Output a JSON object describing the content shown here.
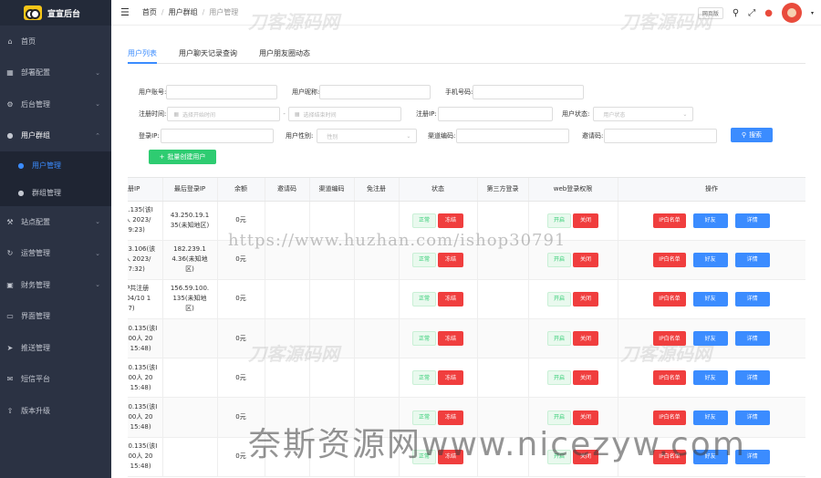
{
  "app": {
    "title": "宣宣后台"
  },
  "sidebar": {
    "items": [
      {
        "label": "首页",
        "icon": "home-icon",
        "chevron": false
      },
      {
        "label": "部署配置",
        "icon": "grid-icon",
        "chevron": true
      },
      {
        "label": "后台管理",
        "icon": "gear-icon",
        "chevron": true
      },
      {
        "label": "用户群组",
        "icon": "user-icon",
        "chevron": true,
        "open": true
      },
      {
        "label": "用户管理",
        "icon": "user-icon",
        "sub": true,
        "active": true
      },
      {
        "label": "群组管理",
        "icon": "users-icon",
        "sub": true
      },
      {
        "label": "站点配置",
        "icon": "wrench-icon",
        "chevron": true
      },
      {
        "label": "运营管理",
        "icon": "refresh-icon",
        "chevron": true
      },
      {
        "label": "财务管理",
        "icon": "wallet-icon",
        "chevron": true
      },
      {
        "label": "界面管理",
        "icon": "monitor-icon",
        "chevron": false
      },
      {
        "label": "推送管理",
        "icon": "send-icon",
        "chevron": false
      },
      {
        "label": "短信平台",
        "icon": "message-icon",
        "chevron": false
      },
      {
        "label": "版本升级",
        "icon": "upgrade-icon",
        "chevron": false
      }
    ]
  },
  "header": {
    "breadcrumbs": [
      "首页",
      "用户群组",
      "用户管理"
    ],
    "badge": "网页版"
  },
  "tabs": [
    "用户列表",
    "用户聊天记录查询",
    "用户朋友圈动态"
  ],
  "filters": {
    "account_label": "用户账号:",
    "nickname_label": "用户昵称:",
    "phone_label": "手机号码:",
    "reg_time_label": "注册时间:",
    "start_placeholder": "选择开始时间",
    "end_placeholder": "选择结束时间",
    "range_sep": "-",
    "reg_ip_label": "注册IP:",
    "status_label": "用户状态:",
    "status_placeholder": "用户状态",
    "login_ip_label": "登录IP:",
    "gender_label": "用户性别:",
    "gender_placeholder": "性别",
    "channel_label": "渠道编码:",
    "invite_label": "邀请码:",
    "search_button": "搜索",
    "batch_button": "批量创建用户"
  },
  "table": {
    "columns": [
      "册IP",
      "最后登录IP",
      "余额",
      "邀请码",
      "渠道编码",
      "免注册",
      "状态",
      "第三方登录",
      "web登录权限",
      "操作"
    ],
    "status_normal": "正常",
    "status_freeze": "冻结",
    "web_open": "开启",
    "web_close": "关闭",
    "action_ip": "IP白名单",
    "action_friend": "好友",
    "action_detail": "详情",
    "rows": [
      {
        "reg_ip": "9.135(该I\n人 2023/\n19:23)",
        "last_ip": "43.250.19.1\n35(未知地区)",
        "balance": "0元"
      },
      {
        "reg_ip": "23.106(该\n人 2023/\n17:32)",
        "last_ip": "182.239.1\n4.36(未知地\n区)",
        "balance": "0元"
      },
      {
        "reg_ip": "IP共注册\n/04/10 1\n07)",
        "last_ip": "156.59.100.\n135(未知地\n区)",
        "balance": "0元"
      },
      {
        "reg_ip": "30.135(该I\n000人 20\n0 15:48)",
        "last_ip": "",
        "balance": "0元"
      },
      {
        "reg_ip": "30.135(该I\n000人 20\n0 15:48)",
        "last_ip": "",
        "balance": "0元"
      },
      {
        "reg_ip": "30.135(该I\n000人 20\n0 15:48)",
        "last_ip": "",
        "balance": "0元"
      },
      {
        "reg_ip": "30.135(该I\n000人 20\n0 15:48)",
        "last_ip": "",
        "balance": "0元"
      }
    ]
  },
  "watermarks": {
    "logo_text": "刀客源码网",
    "url_text": "https://www.huzhan.com/ishop30791",
    "bottom_text": "奈斯资源网www.nicezyw.com"
  }
}
